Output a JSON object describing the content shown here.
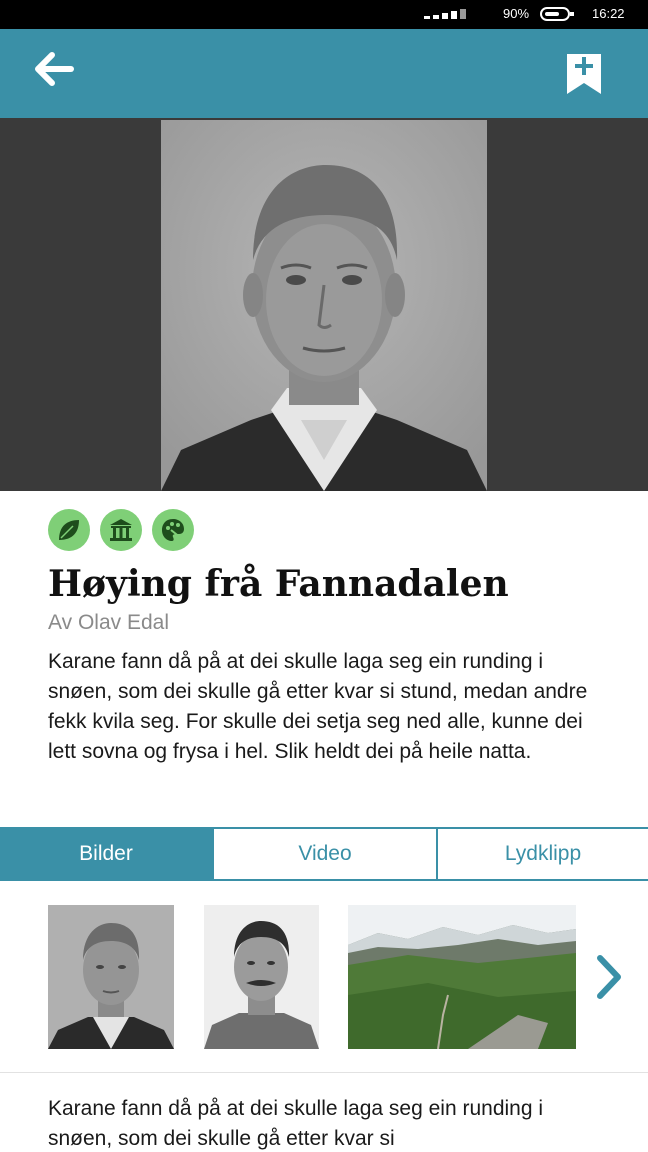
{
  "status_bar": {
    "battery_percent": "90%",
    "time": "16:22"
  },
  "app_bar": {
    "back_icon": "arrow-left-icon",
    "bookmark_icon": "bookmark-add-icon"
  },
  "story": {
    "categories": [
      "leaf-icon",
      "museum-icon",
      "palette-icon"
    ],
    "title": "Høying frå Fannadalen",
    "author": "Av Olav Edal",
    "text": "Karane fann då på at dei skulle laga seg ein runding i snøen, som dei skulle gå etter kvar si stund, medan andre fekk kvila seg. For skulle dei setja seg ned alle, kunne dei lett sovna og frysa i hel. Slik heldt dei på heile natta."
  },
  "tabs": [
    {
      "label": "Bilder",
      "active": true
    },
    {
      "label": "Video",
      "active": false
    },
    {
      "label": "Lydklipp",
      "active": false
    }
  ],
  "gallery": {
    "next_icon": "chevron-right-icon"
  },
  "bottom_text": "Karane fann då på at dei skulle laga seg ein runding i snøen, som dei skulle gå etter kvar si",
  "colors": {
    "accent": "#3a90a7",
    "category": "#7fcf77"
  }
}
